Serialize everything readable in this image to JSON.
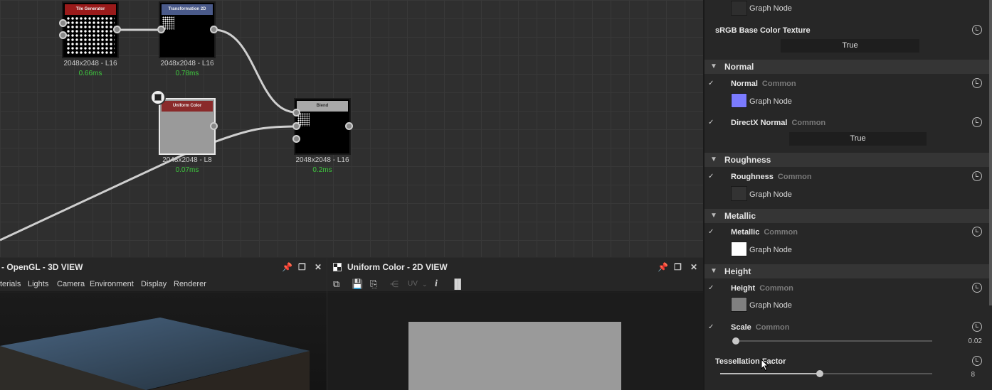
{
  "graph": {
    "nodes": [
      {
        "title": "Tile Generator",
        "res": "2048x2048 - L16",
        "ms": "0.66ms"
      },
      {
        "title": "Transformation 2D",
        "res": "2048x2048 - L16",
        "ms": "0.78ms"
      },
      {
        "title": "Uniform Color",
        "res": "2048x2048 - L8",
        "ms": "0.07ms"
      },
      {
        "title": "Blend",
        "res": "2048x2048 - L16",
        "ms": "0.2ms"
      }
    ]
  },
  "view3d": {
    "title": "- OpenGL - 3D VIEW",
    "menu": [
      "terials",
      "Lights",
      "Camera",
      "Environment",
      "Display",
      "Renderer"
    ]
  },
  "view2d": {
    "title": "Uniform Color - 2D VIEW",
    "uv_label": "UV"
  },
  "props": {
    "top_graph_node": "Graph Node",
    "srgb_label": "sRGB Base Color Texture",
    "srgb_value": "True",
    "sections": {
      "normal": "Normal",
      "roughness": "Roughness",
      "metallic": "Metallic",
      "height": "Height"
    },
    "normal": {
      "label": "Normal",
      "sub": "Common",
      "node": "Graph Node",
      "swatch": "#7b7bff"
    },
    "directx": {
      "label": "DirectX Normal",
      "sub": "Common",
      "value": "True"
    },
    "roughness": {
      "label": "Roughness",
      "sub": "Common",
      "node": "Graph Node",
      "swatch": "#333333"
    },
    "metallic": {
      "label": "Metallic",
      "sub": "Common",
      "node": "Graph Node",
      "swatch": "#ffffff"
    },
    "height": {
      "label": "Height",
      "sub": "Common",
      "node": "Graph Node",
      "swatch": "#808080"
    },
    "scale": {
      "label": "Scale",
      "sub": "Common",
      "value": "0.02",
      "fraction": 0.0
    },
    "tessellation": {
      "label": "Tessellation Factor",
      "value": "8",
      "fraction": 0.47
    }
  }
}
